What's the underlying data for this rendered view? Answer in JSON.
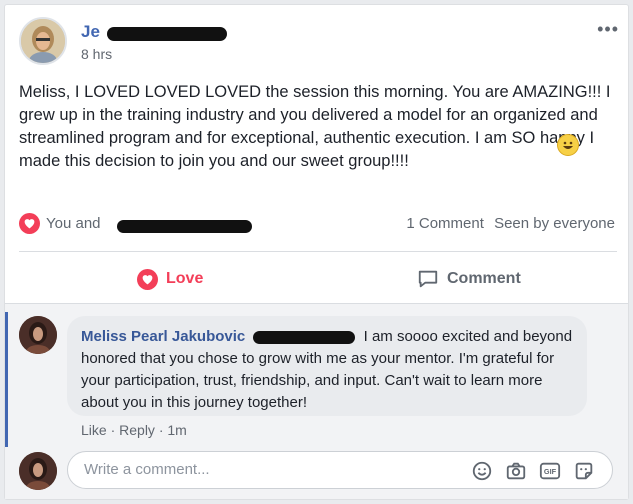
{
  "post": {
    "author": "Je",
    "time": "8 hrs",
    "more": "•••",
    "text": "Meliss, I LOVED LOVED LOVED the session this morning. You are AMAZING!!! I grew up in the training industry and you delivered a model for an organized and streamlined program and for exceptional, authentic execution. I am SO happy I made this decision to join you and our sweet group!!!!",
    "emoji": "😀"
  },
  "stats": {
    "reactions_prefix": "You and",
    "comments_count": "1 Comment",
    "seen": "Seen by everyone"
  },
  "actions": {
    "love": "Love",
    "comment": "Comment"
  },
  "comment": {
    "author": "Meliss Pearl Jakubovic",
    "text": "I am soooo excited and beyond honored that you chose to grow with me as your mentor. I'm grateful for your participation, trust, friendship, and input. Can't wait to learn more about you in this journey together!",
    "like": "Like",
    "reply": "Reply",
    "time": "1m"
  },
  "composer": {
    "placeholder": "Write a comment..."
  },
  "icons": [
    "heart-icon",
    "speech-bubble-icon",
    "smiley-icon",
    "camera-icon",
    "gif-icon",
    "sticker-icon"
  ],
  "colors": {
    "accent": "#4267b2",
    "love": "#f33e58"
  }
}
